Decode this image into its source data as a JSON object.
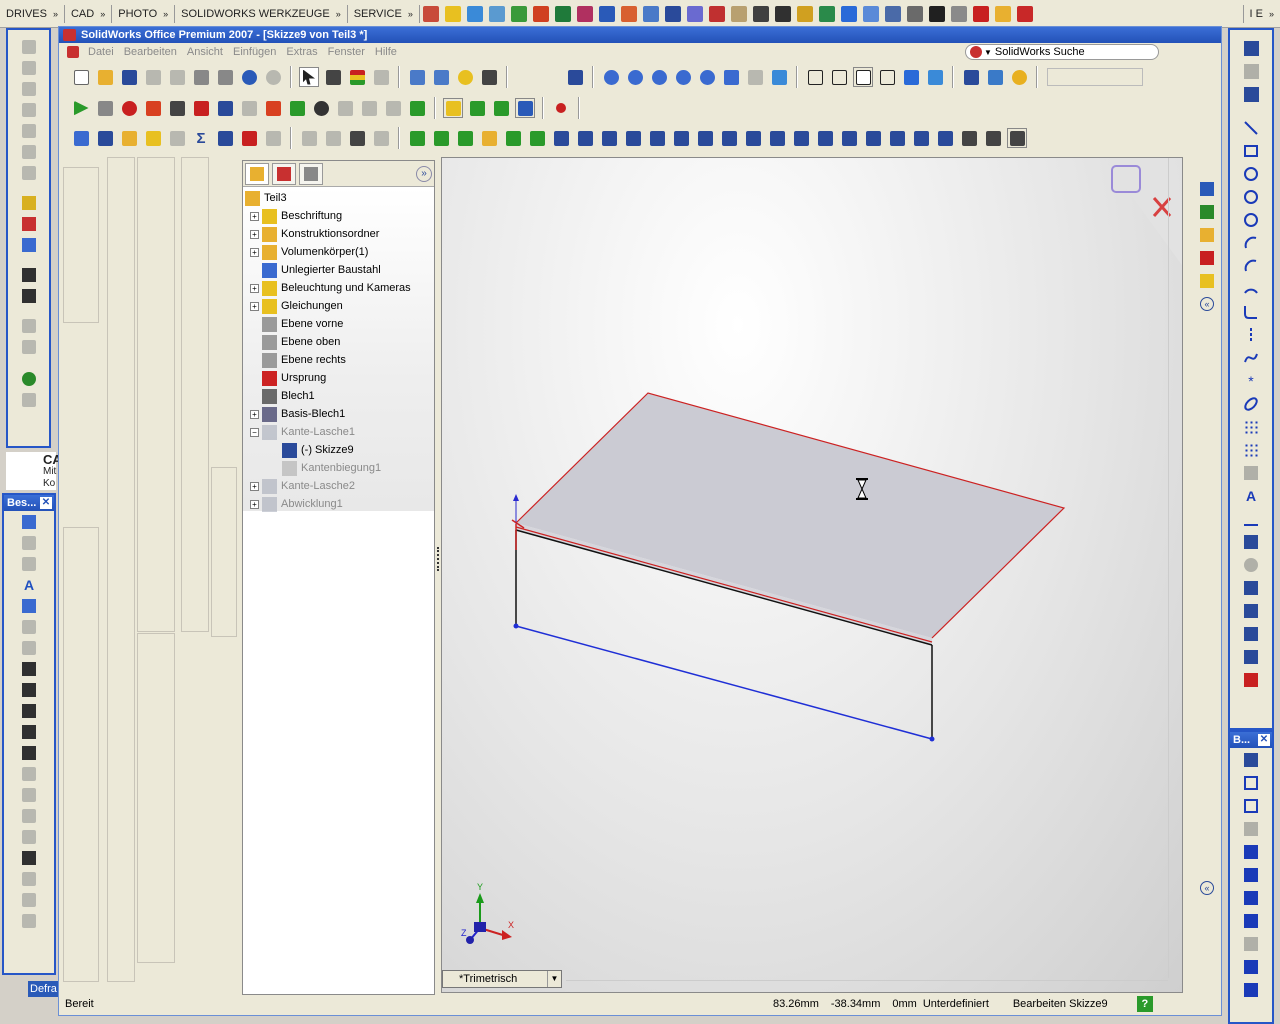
{
  "taskbar": {
    "menus": [
      "DRIVES",
      "CAD",
      "PHOTO",
      "SOLIDWORKS WERKZEUGE",
      "SERVICE"
    ],
    "right_label": "I E"
  },
  "window": {
    "title": "SolidWorks Office Premium 2007 - [Skizze9 von Teil3 *]",
    "menu": [
      "Datei",
      "Bearbeiten",
      "Ansicht",
      "Einfügen",
      "Extras",
      "Fenster",
      "Hilfe"
    ],
    "search_label": "SolidWorks Suche"
  },
  "left_panel": {
    "partial_text": [
      "CA",
      "Mit",
      "Ko"
    ],
    "panel_title": "Bes...",
    "bottom_label": "Defra"
  },
  "right_panel": {
    "title": "B..."
  },
  "feature_manager": {
    "root": "Teil3",
    "items": [
      {
        "label": "Beschriftung",
        "expand": "+",
        "dim": false,
        "indent": 0
      },
      {
        "label": "Konstruktionsordner",
        "expand": "+",
        "dim": false,
        "indent": 0
      },
      {
        "label": "Volumenkörper(1)",
        "expand": "+",
        "dim": false,
        "indent": 0
      },
      {
        "label": "Unlegierter Baustahl",
        "expand": "",
        "dim": false,
        "indent": 0
      },
      {
        "label": "Beleuchtung und Kameras",
        "expand": "+",
        "dim": false,
        "indent": 0
      },
      {
        "label": "Gleichungen",
        "expand": "+",
        "dim": false,
        "indent": 0
      },
      {
        "label": "Ebene vorne",
        "expand": "",
        "dim": false,
        "indent": 0
      },
      {
        "label": "Ebene oben",
        "expand": "",
        "dim": false,
        "indent": 0
      },
      {
        "label": "Ebene rechts",
        "expand": "",
        "dim": false,
        "indent": 0
      },
      {
        "label": "Ursprung",
        "expand": "",
        "dim": false,
        "indent": 0
      },
      {
        "label": "Blech1",
        "expand": "",
        "dim": false,
        "indent": 0
      },
      {
        "label": "Basis-Blech1",
        "expand": "+",
        "dim": false,
        "indent": 0
      },
      {
        "label": "Kante-Lasche1",
        "expand": "−",
        "dim": true,
        "indent": 0
      },
      {
        "label": "(-) Skizze9",
        "expand": "",
        "dim": false,
        "indent": 1
      },
      {
        "label": "Kantenbiegung1",
        "expand": "",
        "dim": true,
        "indent": 1
      },
      {
        "label": "Kante-Lasche2",
        "expand": "+",
        "dim": true,
        "indent": 0
      },
      {
        "label": "Abwicklung1",
        "expand": "+",
        "dim": true,
        "indent": 0
      }
    ]
  },
  "viewport": {
    "view_orientation": "*Trimetrisch",
    "axes": {
      "x": "X",
      "y": "Y",
      "z": "Z"
    }
  },
  "status": {
    "ready": "Bereit",
    "x": "83.26mm",
    "y": "-38.34mm",
    "z": "0mm",
    "state": "Unterdefiniert",
    "mode": "Bearbeiten Skizze9",
    "help": "?"
  },
  "colors": {
    "accent": "#2351b8",
    "sketch_red": "#cc2222",
    "sketch_blue": "#1f2fd6"
  }
}
